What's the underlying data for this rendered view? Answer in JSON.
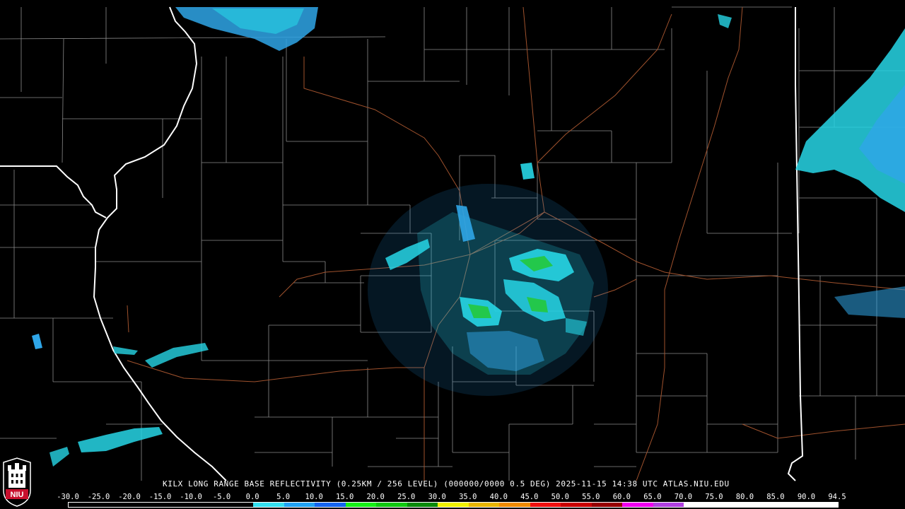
{
  "product_title": "KILX LONG RANGE BASE REFLECTIVITY (0.25KM / 256 LEVEL) (000000/0000 0.5 DEG) 2025-11-15 14:38 UTC  ATLAS.NIU.EDU",
  "logo_text": "NIU",
  "colors": {
    "background": "#000000",
    "county_lines": "#8a8a8a",
    "state_lines": "#ffffff",
    "highways": "#a0522d",
    "echo_light": "#2fa6e8",
    "echo_cyan": "#27d6e6",
    "echo_green": "#24c83c",
    "logo_red": "#c8102e"
  },
  "color_scale": {
    "labels": [
      "-30.0",
      "-25.0",
      "-20.0",
      "-15.0",
      "-10.0",
      "-5.0",
      "0.0",
      "5.0",
      "10.0",
      "15.0",
      "20.0",
      "25.0",
      "30.0",
      "35.0",
      "40.0",
      "45.0",
      "50.0",
      "55.0",
      "60.0",
      "65.0",
      "70.0",
      "75.0",
      "80.0",
      "85.0",
      "90.0",
      "94.5"
    ],
    "segments": [
      "#000000",
      "#000000",
      "#000000",
      "#000000",
      "#000000",
      "#000000",
      "#33e0f0",
      "#21a3f5",
      "#1565f0",
      "#16f016",
      "#10c810",
      "#0a8a0a",
      "#f0f000",
      "#e8b400",
      "#f08a00",
      "#f01010",
      "#c80000",
      "#960000",
      "#f000f0",
      "#b040e0",
      "#ffffff",
      "#ffffff",
      "#ffffff",
      "#ffffff",
      "#ffffff"
    ]
  }
}
